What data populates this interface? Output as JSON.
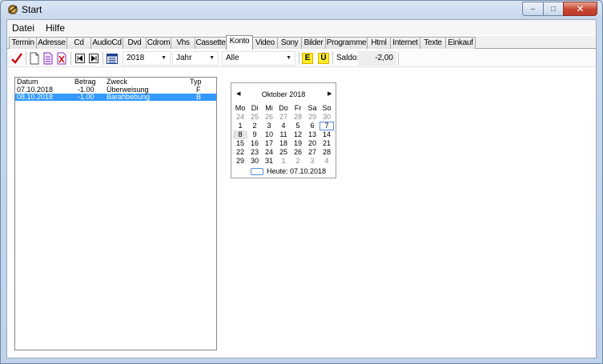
{
  "window": {
    "title": "Start",
    "min_glyph": "–",
    "max_glyph": "□",
    "close_glyph": "✕"
  },
  "menu": [
    "Datei",
    "Hilfe"
  ],
  "tabs": [
    {
      "label": "Termin"
    },
    {
      "label": "Adresse"
    },
    {
      "label": "Cd"
    },
    {
      "label": "AudioCd"
    },
    {
      "label": "Dvd"
    },
    {
      "label": "Cdrom"
    },
    {
      "label": "Vhs"
    },
    {
      "label": "Cassette"
    },
    {
      "label": "Konto",
      "active": true
    },
    {
      "label": "Video"
    },
    {
      "label": "Sony"
    },
    {
      "label": "Bilder"
    },
    {
      "label": "Programme"
    },
    {
      "label": "Html"
    },
    {
      "label": "Internet"
    },
    {
      "label": "Texte"
    },
    {
      "label": "Einkauf"
    }
  ],
  "toolbar": {
    "year": "2018",
    "period": "Jahr",
    "filter": "Alle",
    "btn_e": "E",
    "btn_u": "Ü",
    "saldo_label": "Saldo:",
    "saldo_value": "-2,00",
    "icons": [
      "checkmark-icon",
      "new-document-icon",
      "copy-document-icon",
      "delete-document-icon",
      "first-record-icon",
      "last-record-icon",
      "calendar-icon"
    ]
  },
  "list": {
    "headers": {
      "datum": "Datum",
      "betrag": "Betrag",
      "zweck": "Zweck",
      "typ": "Typ"
    },
    "rows": [
      {
        "datum": "07.10.2018",
        "betrag": "-1.00",
        "zweck": "Überweisung",
        "typ": "F",
        "selected": false
      },
      {
        "datum": "08.10.2018",
        "betrag": "-1.00",
        "zweck": "Barahbebung",
        "typ": "B",
        "selected": true
      }
    ]
  },
  "calendar": {
    "title": "Oktober 2018",
    "prev": "◀",
    "next": "▶",
    "weekdays": [
      "Mo",
      "Di",
      "Mi",
      "Do",
      "Fr",
      "Sa",
      "So"
    ],
    "weeks": [
      [
        {
          "d": "24",
          "o": true
        },
        {
          "d": "25",
          "o": true
        },
        {
          "d": "26",
          "o": true
        },
        {
          "d": "27",
          "o": true
        },
        {
          "d": "28",
          "o": true
        },
        {
          "d": "29",
          "o": true
        },
        {
          "d": "30",
          "o": true
        }
      ],
      [
        {
          "d": "1"
        },
        {
          "d": "2"
        },
        {
          "d": "3"
        },
        {
          "d": "4"
        },
        {
          "d": "5"
        },
        {
          "d": "6"
        },
        {
          "d": "7",
          "today": true
        }
      ],
      [
        {
          "d": "8",
          "sel": true
        },
        {
          "d": "9"
        },
        {
          "d": "10"
        },
        {
          "d": "11"
        },
        {
          "d": "12"
        },
        {
          "d": "13"
        },
        {
          "d": "14"
        }
      ],
      [
        {
          "d": "15"
        },
        {
          "d": "16"
        },
        {
          "d": "17"
        },
        {
          "d": "18"
        },
        {
          "d": "19"
        },
        {
          "d": "20"
        },
        {
          "d": "21"
        }
      ],
      [
        {
          "d": "22"
        },
        {
          "d": "23"
        },
        {
          "d": "24"
        },
        {
          "d": "25"
        },
        {
          "d": "26"
        },
        {
          "d": "27"
        },
        {
          "d": "28"
        }
      ],
      [
        {
          "d": "29"
        },
        {
          "d": "30"
        },
        {
          "d": "31"
        },
        {
          "d": "1",
          "o": true
        },
        {
          "d": "2",
          "o": true
        },
        {
          "d": "3",
          "o": true
        },
        {
          "d": "4",
          "o": true
        }
      ]
    ],
    "today_label": "Heute: 07.10.2018"
  },
  "colors": {
    "selection": "#3399ff",
    "accent_yellow": "#ffee22",
    "check_red": "#cc1111",
    "link_blue": "#5a8fd6"
  }
}
